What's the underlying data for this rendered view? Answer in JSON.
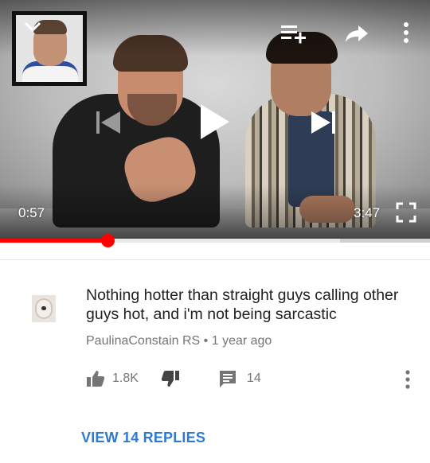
{
  "player": {
    "current_time": "0:57",
    "total_time": "3:47",
    "played_fraction": 0.25,
    "buffered_fraction": 0.79,
    "progress_color": "#ff0000",
    "icons": {
      "collapse": "chevron-down-icon",
      "add_to_queue": "playlist-add-icon",
      "share": "share-icon",
      "more": "more-vert-icon",
      "previous": "skip-previous-icon",
      "play": "play-icon",
      "next": "skip-next-icon",
      "fullscreen": "fullscreen-icon"
    }
  },
  "comment": {
    "text": "Nothing hotter than straight guys calling other guys hot, and i'm not being sarcastic",
    "author": "PaulinaConstain RS",
    "separator": "•",
    "age": "1 year ago",
    "like_count": "1.8K",
    "reply_count": "14",
    "view_replies_label": "VIEW 14 REPLIES",
    "link_color": "#2d7ad3"
  }
}
